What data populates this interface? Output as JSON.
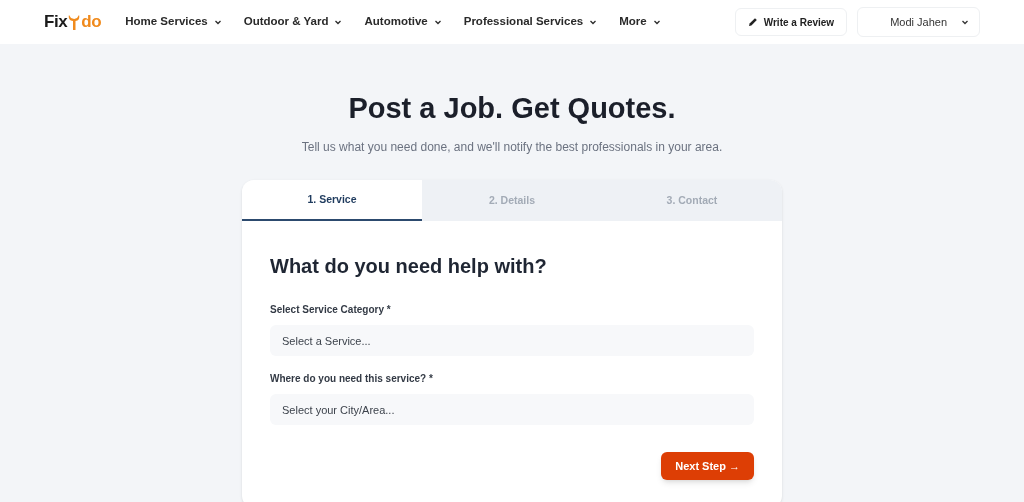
{
  "logo": {
    "left": "Fix",
    "right": "do"
  },
  "nav": [
    {
      "label": "Home Services"
    },
    {
      "label": "Outdoor & Yard"
    },
    {
      "label": "Automotive"
    },
    {
      "label": "Professional Services"
    },
    {
      "label": "More"
    }
  ],
  "write_review": "Write a Review",
  "user_menu": "Modi Jahen",
  "title": "Post a Job. Get Quotes.",
  "subtitle": "Tell us what you need done, and we'll notify the best professionals in your area.",
  "tabs": [
    {
      "label": "1. Service",
      "selected": true
    },
    {
      "label": "2. Details",
      "selected": false
    },
    {
      "label": "3. Contact",
      "selected": false
    }
  ],
  "heading": "What do you need help with?",
  "fields": [
    {
      "label": "Select Service Category *",
      "placeholder": "Select a Service..."
    },
    {
      "label": "Where do you need this service? *",
      "placeholder": "Select your City/Area..."
    }
  ],
  "next_button": "Next Step →"
}
